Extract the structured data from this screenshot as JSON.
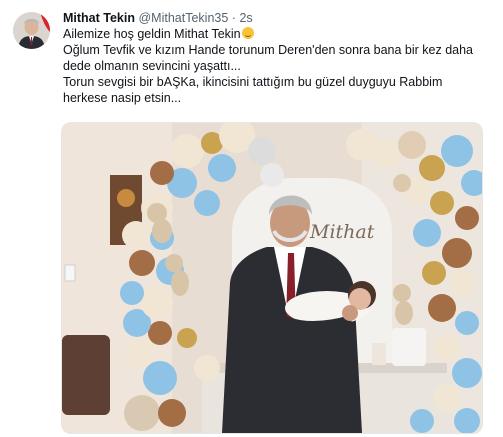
{
  "tweet": {
    "display_name": "Mithat Tekin",
    "handle": "@MithatTekin35",
    "separator": "·",
    "time": "2s",
    "lines": [
      "Ailemize hoş geldin Mithat Tekin",
      "Oğlum Tevfik ve kızım Hande torunum Deren'den sonra bana bir kez daha",
      "dede olmanın sevincini yaşattı...",
      "Torun sevgisi bir bAŞKa, ikincisini tattığım bu güzel duyguyu Rabbim",
      "herkese nasip etsin..."
    ],
    "emoji_icon": "smiling-face-icon"
  },
  "photo": {
    "backdrop_text": "Mithat",
    "colors": {
      "wall": "#e9e2d8",
      "balloon_blue": "#8fc3e6",
      "balloon_cream": "#f1e6d4",
      "balloon_brown": "#a36d45",
      "balloon_gold": "#c9a34f",
      "suit": "#2b2d33",
      "tie": "#8a1f2c"
    }
  }
}
